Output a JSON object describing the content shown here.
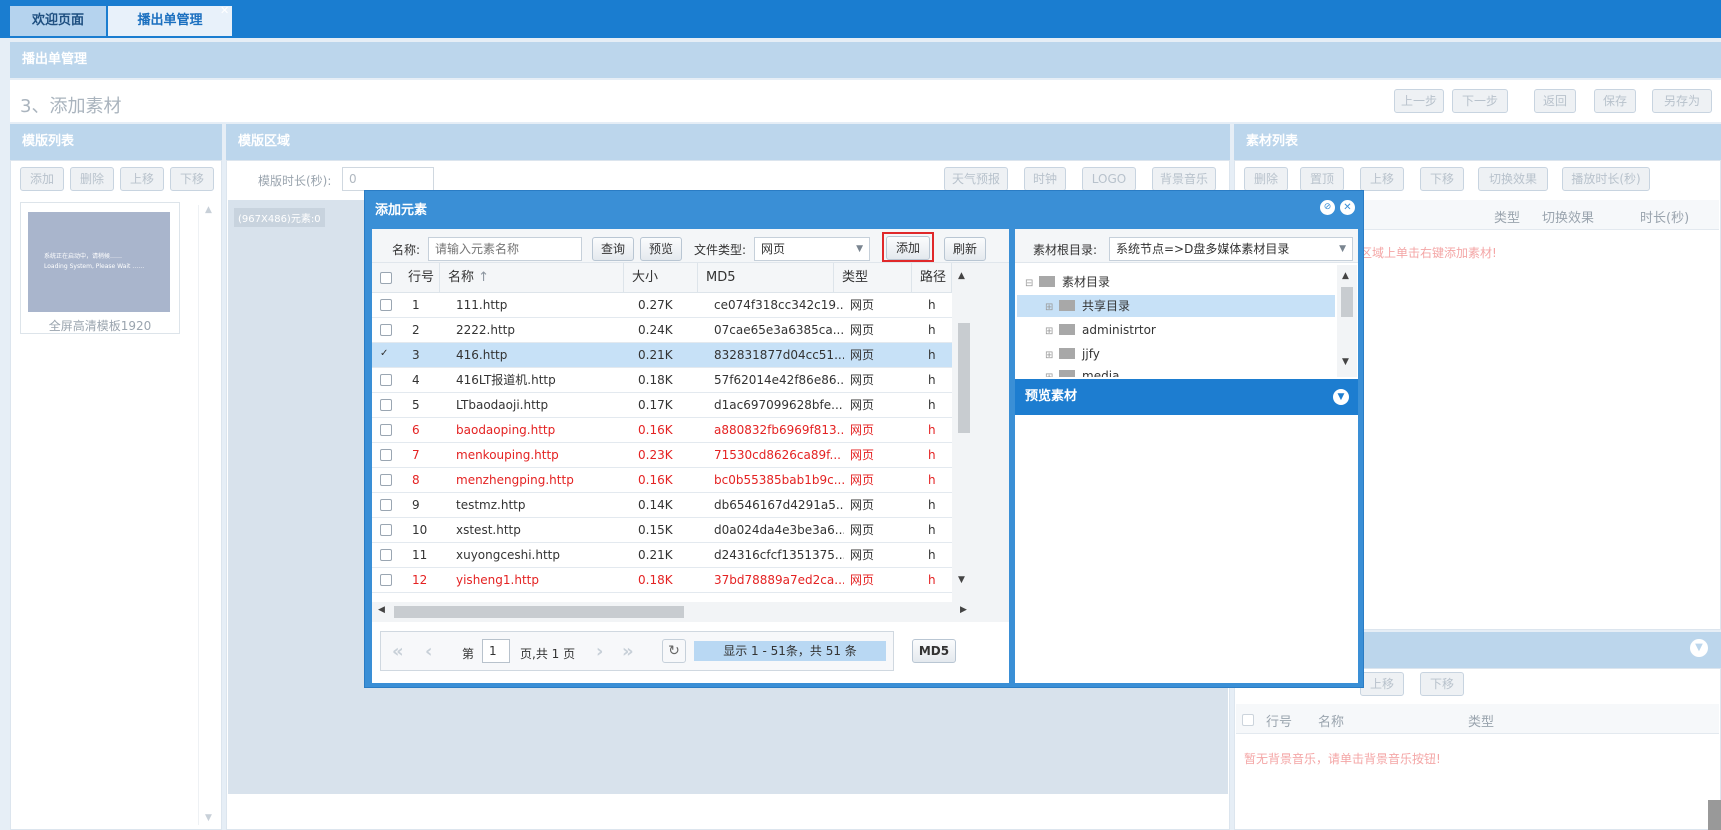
{
  "tabs": [
    {
      "label": "欢迎页面"
    },
    {
      "label": "播出单管理"
    }
  ],
  "page": {
    "header": "播出单管理",
    "step_title": "3、添加素材",
    "step_buttons": [
      "上一步",
      "下一步",
      "返回",
      "保存",
      "另存为"
    ]
  },
  "template_list": {
    "title": "模版列表",
    "buttons": [
      "添加",
      "删除",
      "上移",
      "下移"
    ],
    "thumb_text_1": "系统正在启动中，请稍候……",
    "thumb_text_2": "Loading System, Please Wait ……",
    "thumb_caption": "全屏高清模板1920"
  },
  "template_area": {
    "title": "模版区域",
    "duration_label": "模版时长(秒):",
    "duration_value": "0",
    "buttons": [
      "天气预报",
      "时钟",
      "LOGO",
      "背景音乐"
    ],
    "region_label": "(967X486)元素:0"
  },
  "material_list": {
    "title": "素材列表",
    "buttons": [
      "删除",
      "置顶",
      "上移",
      "下移",
      "切换效果",
      "播放时长(秒)"
    ],
    "columns": [
      "类型",
      "切换效果",
      "时长(秒)"
    ],
    "hint": "区域上单击右键添加素材!"
  },
  "bgmusic": {
    "buttons": [
      "上移",
      "下移"
    ],
    "columns": [
      "行号",
      "名称",
      "类型"
    ],
    "hint": "暂无背景音乐，请单击背景音乐按钮!"
  },
  "dialog": {
    "title": "添加元素",
    "search": {
      "name_label": "名称:",
      "placeholder": "请输入元素名称",
      "query": "查询",
      "preview": "预览",
      "type_label": "文件类型:",
      "type_value": "网页",
      "add": "添加",
      "refresh": "刷新"
    },
    "columns": [
      "行号",
      "名称",
      "大小",
      "MD5",
      "类型",
      "路径"
    ],
    "rows": [
      {
        "no": "1",
        "name": "111.http",
        "size": "0.27K",
        "md5": "ce074f318cc342c19...",
        "type": "网页",
        "path": "h",
        "red": false,
        "checked": false
      },
      {
        "no": "2",
        "name": "2222.http",
        "size": "0.24K",
        "md5": "07cae65e3a6385ca...",
        "type": "网页",
        "path": "h",
        "red": false,
        "checked": false
      },
      {
        "no": "3",
        "name": "416.http",
        "size": "0.21K",
        "md5": "832831877d04cc51...",
        "type": "网页",
        "path": "h",
        "red": false,
        "checked": true
      },
      {
        "no": "4",
        "name": "416LT报道机.http",
        "size": "0.18K",
        "md5": "57f62014e42f86e86...",
        "type": "网页",
        "path": "h",
        "red": false,
        "checked": false
      },
      {
        "no": "5",
        "name": "LTbaodaoji.http",
        "size": "0.17K",
        "md5": "d1ac697099628bfe...",
        "type": "网页",
        "path": "h",
        "red": false,
        "checked": false
      },
      {
        "no": "6",
        "name": "baodaoping.http",
        "size": "0.16K",
        "md5": "a880832fb6969f813...",
        "type": "网页",
        "path": "h",
        "red": true,
        "checked": false
      },
      {
        "no": "7",
        "name": "menkouping.http",
        "size": "0.23K",
        "md5": "71530cd8626ca89f...",
        "type": "网页",
        "path": "h",
        "red": true,
        "checked": false
      },
      {
        "no": "8",
        "name": "menzhengping.http",
        "size": "0.16K",
        "md5": "bc0b55385bab1b9c...",
        "type": "网页",
        "path": "h",
        "red": true,
        "checked": false
      },
      {
        "no": "9",
        "name": "testmz.http",
        "size": "0.14K",
        "md5": "db6546167d4291a5...",
        "type": "网页",
        "path": "h",
        "red": false,
        "checked": false
      },
      {
        "no": "10",
        "name": "xstest.http",
        "size": "0.15K",
        "md5": "d0a024da4e3be3a6...",
        "type": "网页",
        "path": "h",
        "red": false,
        "checked": false
      },
      {
        "no": "11",
        "name": "xuyongceshi.http",
        "size": "0.21K",
        "md5": "d24316cfcf1351375...",
        "type": "网页",
        "path": "h",
        "red": false,
        "checked": false
      },
      {
        "no": "12",
        "name": "yisheng1.http",
        "size": "0.18K",
        "md5": "37bd78889a7ed2ca...",
        "type": "网页",
        "path": "h",
        "red": true,
        "checked": false
      }
    ],
    "pager": {
      "page_label": "第",
      "page_value": "1",
      "page_total": "页,共 1 页",
      "status": "显示 1 - 51条，共 51 条",
      "md5_button": "MD5"
    },
    "tree": {
      "root_label": "素材根目录:",
      "root_value": "系统节点=>D盘多媒体素材目录",
      "nodes": [
        {
          "label": "素材目录"
        },
        {
          "label": "共享目录"
        },
        {
          "label": "administrtor"
        },
        {
          "label": "jjfy"
        },
        {
          "label": "media"
        }
      ]
    },
    "preview_title": "预览素材"
  }
}
